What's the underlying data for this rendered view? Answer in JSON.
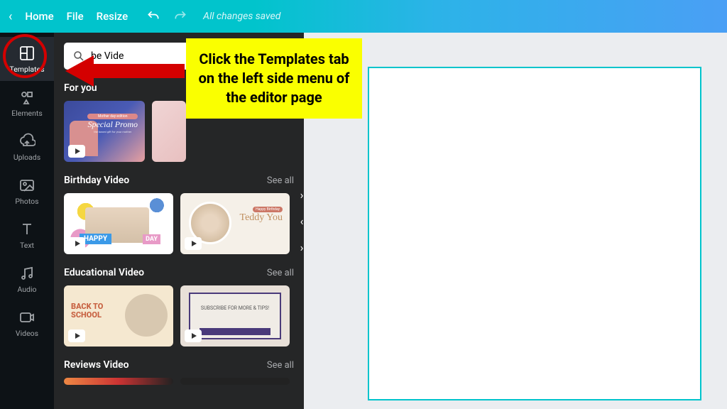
{
  "topbar": {
    "home": "Home",
    "file": "File",
    "resize": "Resize",
    "save_status": "All changes saved"
  },
  "sidemenu": {
    "templates": "Templates",
    "elements": "Elements",
    "uploads": "Uploads",
    "photos": "Photos",
    "text": "Text",
    "audio": "Audio",
    "videos": "Videos"
  },
  "search": {
    "value": "",
    "visible_text": "be Vide"
  },
  "sections": [
    {
      "title": "For you",
      "see_all": ""
    },
    {
      "title": "Birthday Video",
      "see_all": "See all"
    },
    {
      "title": "Educational Video",
      "see_all": "See all"
    },
    {
      "title": "Reviews Video",
      "see_all": "See all"
    }
  ],
  "thumbs": {
    "foryou_tag": "Mother day edition",
    "foryou_main": "Special Promo",
    "foryou_sub": "the based gift for your mother",
    "bday_badge": "HAPPY",
    "bday_badge2": "DAY",
    "bday2_tag": "Happy Birthday",
    "bday2_name": "Teddy You",
    "edu1_line1": "BACK TO",
    "edu1_line2": "SCHOOL",
    "edu2_text": "SUBSCRIBE FOR MORE & TIPS!"
  },
  "callout": "Click the Templates tab on the left side menu of the editor page"
}
